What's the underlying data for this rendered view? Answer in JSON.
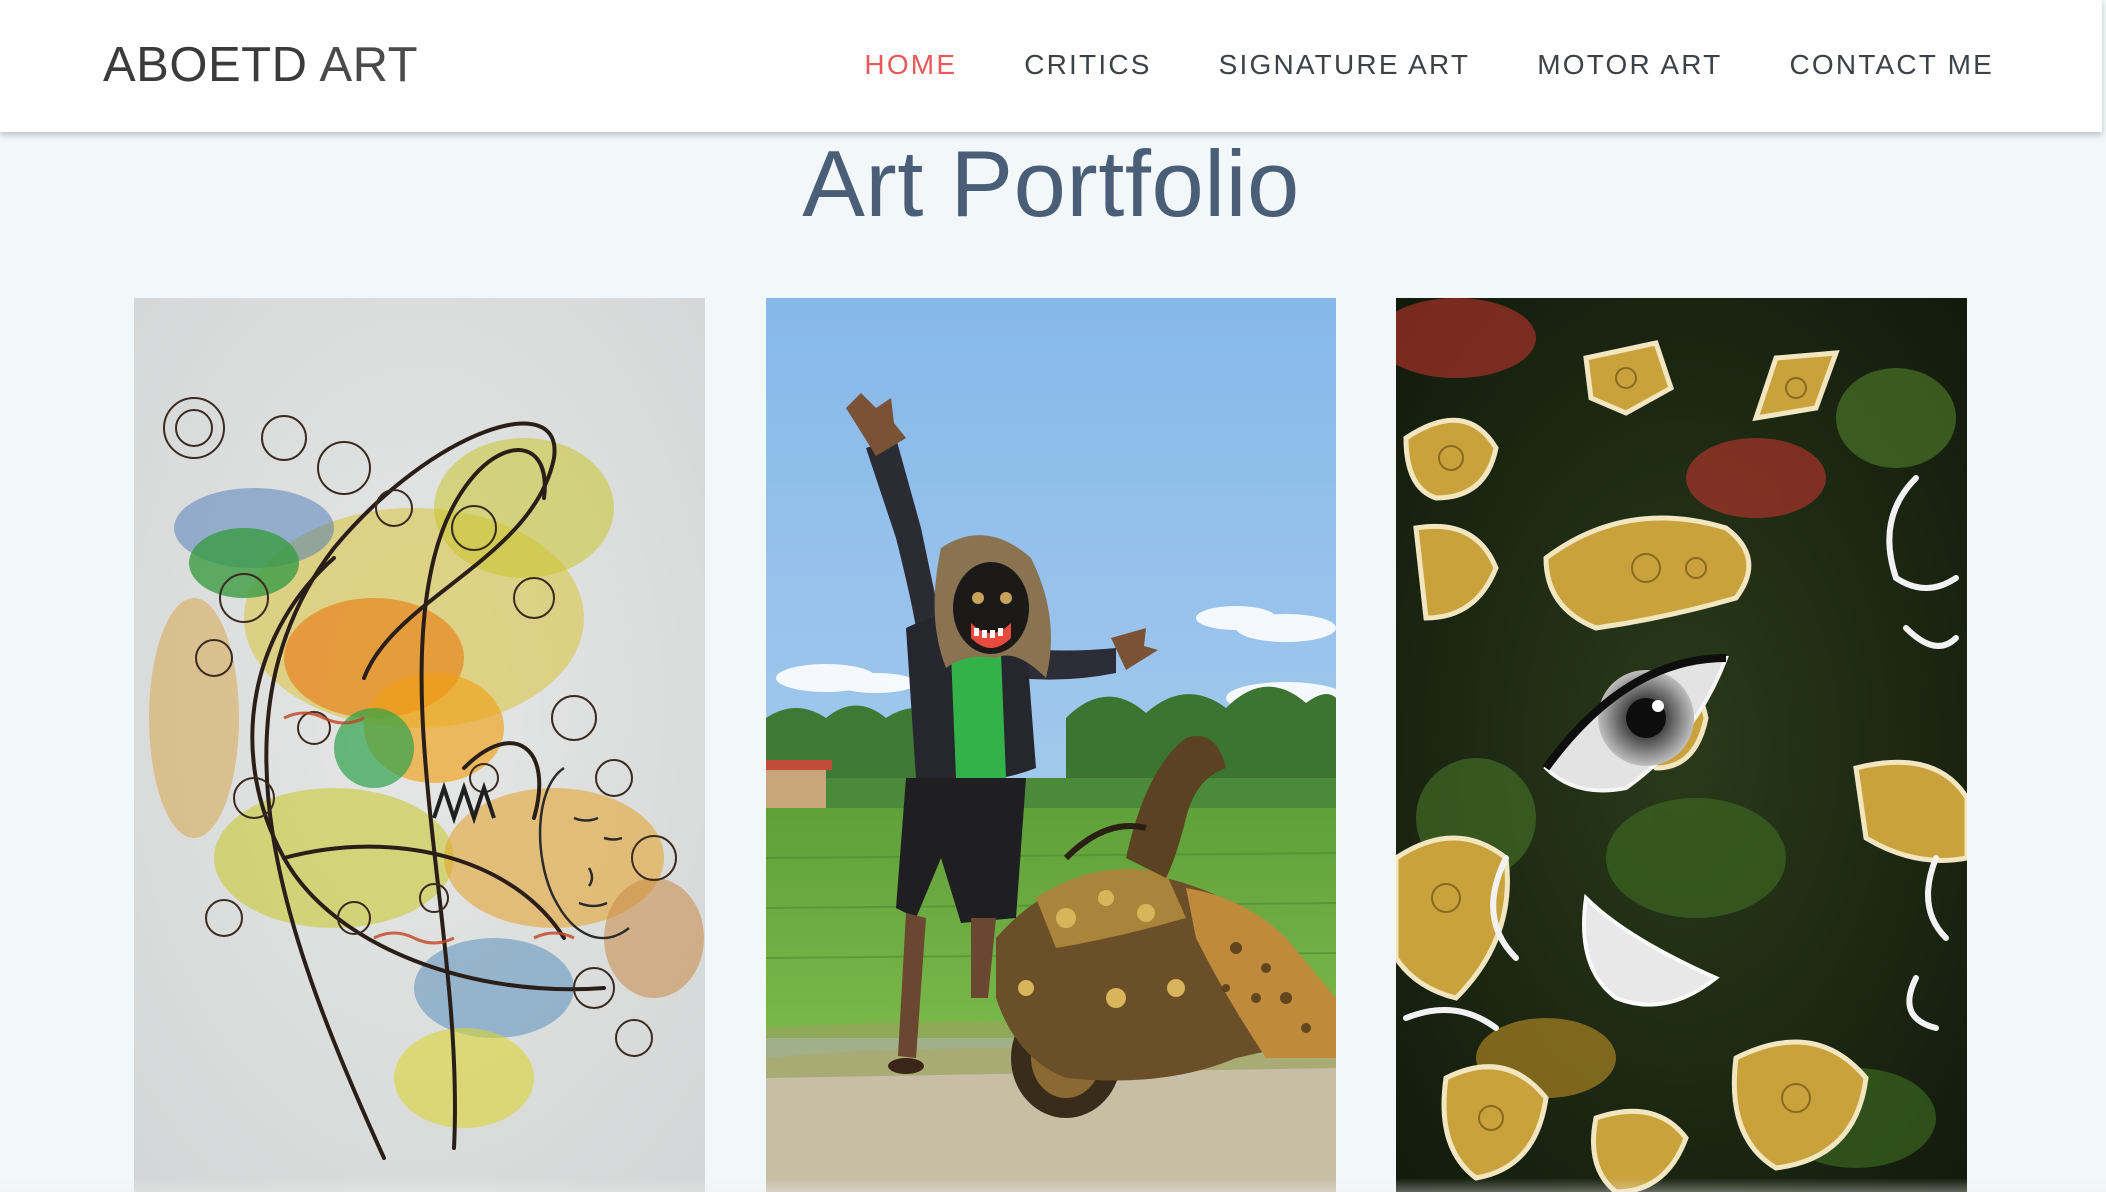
{
  "header": {
    "brand_bold": "ABOETD",
    "brand_light": "ART",
    "nav": [
      {
        "label": "HOME",
        "active": true
      },
      {
        "label": "CRITICS",
        "active": false
      },
      {
        "label": "SIGNATURE ART",
        "active": false
      },
      {
        "label": "MOTOR ART",
        "active": false
      },
      {
        "label": "CONTACT ME",
        "active": false
      }
    ]
  },
  "main": {
    "title": "Art Portfolio"
  },
  "colors": {
    "accent": "#e8595a",
    "nav_text": "#3d4248",
    "title": "#4a5e78",
    "page_bg": "#f2f7f9",
    "header_bg": "#ffffff"
  }
}
